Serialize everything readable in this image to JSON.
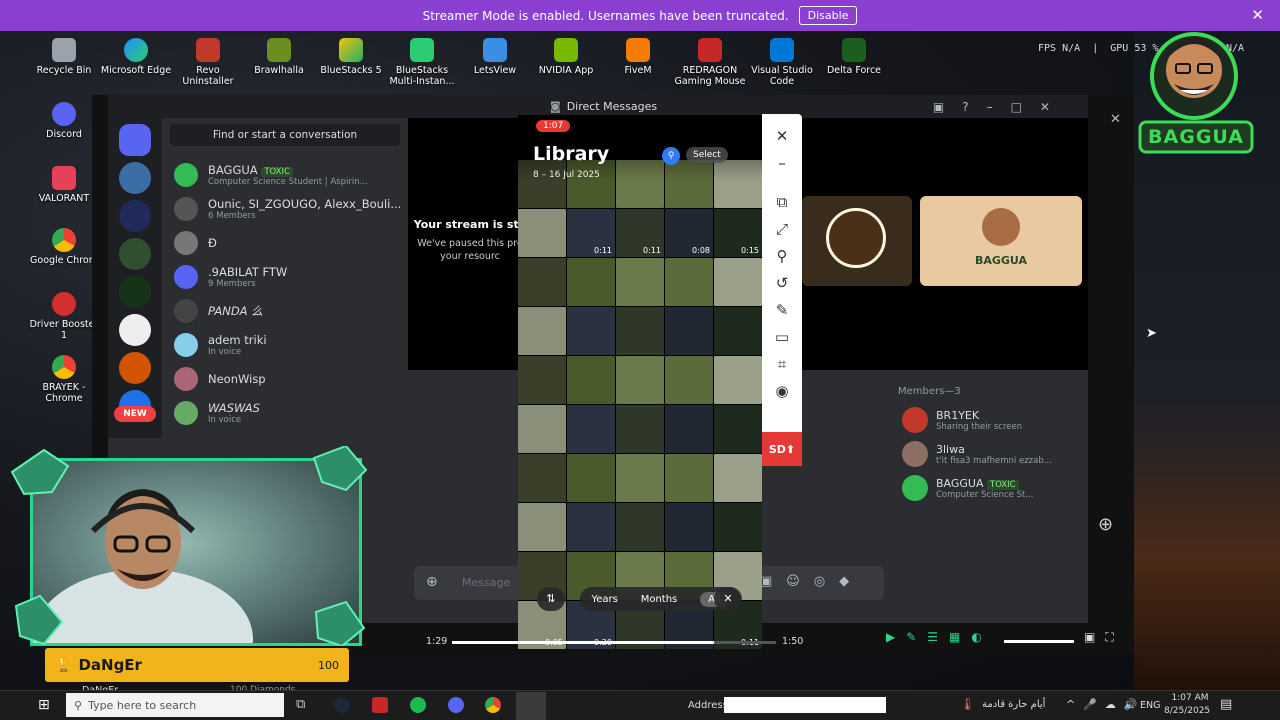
{
  "banner": {
    "text": "Streamer Mode is enabled. Usernames have been truncated.",
    "button": "Disable"
  },
  "desktop": {
    "top_icons": [
      "Recycle Bin",
      "Microsoft Edge",
      "Revo Uninstaller",
      "Brawlhalla",
      "BlueStacks 5",
      "BlueStacks Multi-Instan...",
      "LetsView",
      "NVIDIA App",
      "FiveM",
      "REDRAGON Gaming Mouse",
      "Visual Studio Code",
      "Delta Force"
    ],
    "left_icons": [
      "Discord",
      "VALORANT",
      "Google Chrom",
      "Driver Booster 1",
      "BRAYEK - Chrome"
    ]
  },
  "stats": {
    "fps_label": "FPS",
    "fps_value": "N/A",
    "gpu_label": "GPU",
    "gpu_value": "53 %",
    "other": "N/A"
  },
  "discord": {
    "title": "Direct Messages",
    "search_placeholder": "Find or start a conversation",
    "new_badge": "NEW",
    "dms": [
      {
        "name": "BAGGUA",
        "tag": "TOXIC",
        "sub": "Computer Science Student | Aspirin..."
      },
      {
        "name": "Ounic, SI_ZGOUGO, Alexx_Bouli...",
        "sub": "6 Members"
      },
      {
        "name": "Ð",
        "sub": ""
      },
      {
        "name": ".9ABILAT FTW",
        "sub": "9 Members"
      },
      {
        "name": "PANDA 么",
        "sub": ""
      },
      {
        "name": "adem triki",
        "sub": "In voice"
      },
      {
        "name": "NeonWisp",
        "sub": ""
      },
      {
        "name": "WASWAS",
        "sub": "In voice"
      }
    ],
    "stream_notice_title": "Your stream is stil",
    "stream_notice_body": "We've paused this pre",
    "stream_notice_body2": "your resourc",
    "tile_label": "BAGGUA",
    "members_header": "Members—3",
    "members": [
      {
        "name": "BR1YEK",
        "sub": "Sharing their screen"
      },
      {
        "name": "3liwa",
        "sub": "t'it fisa3 mafhemni ezzab..."
      },
      {
        "name": "BAGGUA",
        "tag": "TOXIC",
        "sub": "Computer Science St..."
      }
    ],
    "message_placeholder": "Message"
  },
  "phone": {
    "time": "1:07",
    "title": "Library",
    "date_range": "8 – 16 Jul 2025",
    "select": "Select",
    "durations": [
      "0:11",
      "0:11",
      "0:08",
      "0:15",
      "0:05",
      "0:20",
      "0:11"
    ],
    "tabs": [
      "Years",
      "Months",
      "All"
    ]
  },
  "toolbar": {
    "sd_label": "SD"
  },
  "player": {
    "elapsed": "1:29",
    "total": "1:50",
    "progress": 0.81
  },
  "overlay": {
    "name": "DaNgEr",
    "points": "100",
    "sub_name": "DaNgEr",
    "sub_points": "100 Diamonds",
    "logo": "BAGGUA"
  },
  "taskbar": {
    "search_placeholder": "Type here to search",
    "address_label": "Address",
    "arabic_text": "أيام حارة قادمة",
    "lang": "ENG",
    "time": "1:07 AM",
    "date": "8/25/2025"
  },
  "colors": {
    "banner": "#8a3fd1",
    "discord_bg": "#2b2d31",
    "overlay_gold": "#f2b41b",
    "cam_border": "#2ad68a",
    "sd": "#e53935"
  }
}
